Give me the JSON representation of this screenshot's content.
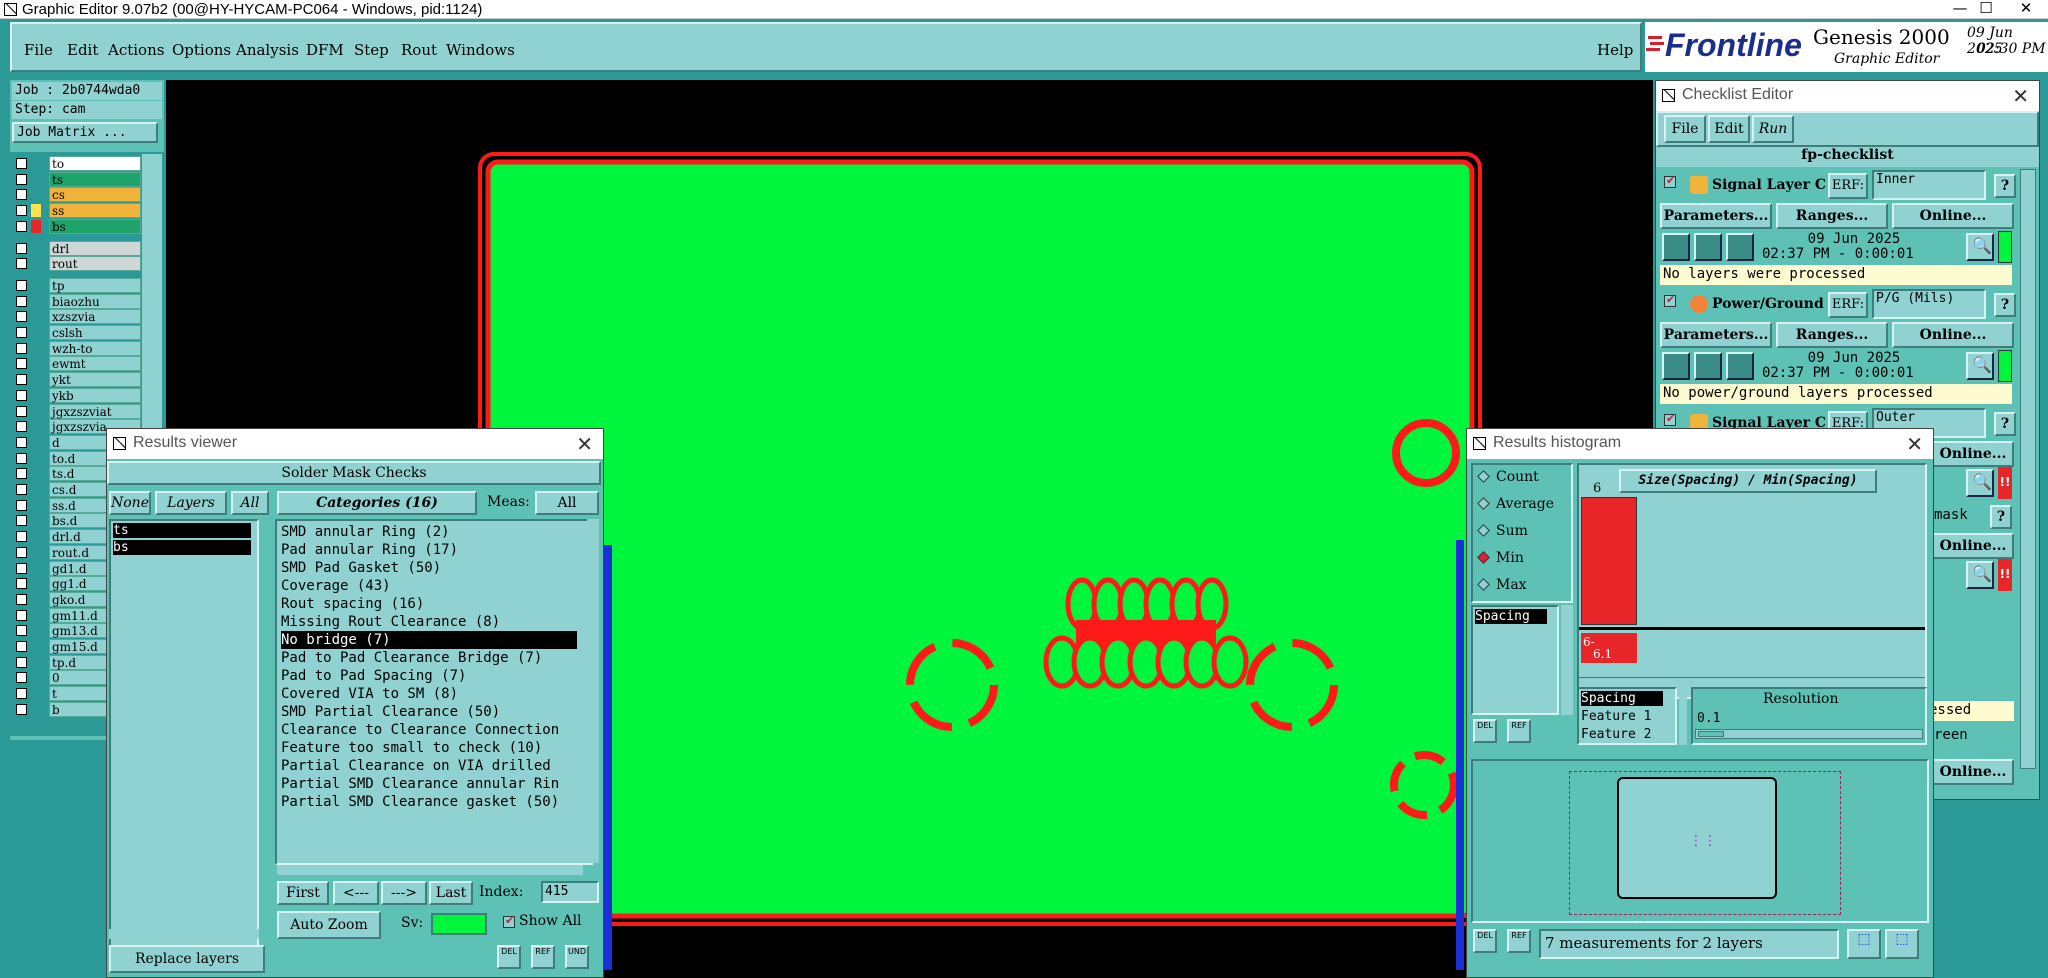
{
  "titlebar": {
    "title": "Graphic Editor 9.07b2 (00@HY-HYCAM-PC064 - Windows, pid:1124)",
    "min": "—",
    "max": "☐",
    "close": "✕"
  },
  "menubar": {
    "items": [
      "File",
      "Edit",
      "Actions",
      "Options",
      "Analysis",
      "DFM",
      "Step",
      "Rout",
      "Windows"
    ],
    "help": "Help"
  },
  "logo": {
    "brand": "Frontline",
    "product": "Genesis 2000",
    "sub": "Graphic Editor",
    "date": "09 Jun 2025",
    "time": "02:30 PM"
  },
  "left_panel": {
    "job": "Job : 2b0744wda0",
    "step": "Step: cam",
    "job_matrix": "Job Matrix ...",
    "layers": [
      {
        "name": "to",
        "color": "#ffffff",
        "swatch": ""
      },
      {
        "name": "ts",
        "color": "#1ea46a",
        "swatch": ""
      },
      {
        "name": "cs",
        "color": "#f1b43a",
        "swatch": ""
      },
      {
        "name": "ss",
        "color": "#f1b43a",
        "swatch": "#ffe14d"
      },
      {
        "name": "bs",
        "color": "#1ea46a",
        "swatch": "#e8262a"
      }
    ],
    "layers2": [
      "drl",
      "rout"
    ],
    "layers3": [
      "tp",
      "biaozhu",
      "xzszvia",
      "cslsh",
      "wzh-to",
      "ewmt",
      "ykt",
      "ykb",
      "jgxzszviat",
      "jgxzszvia",
      "d",
      "to.d",
      "ts.d",
      "cs.d",
      "ss.d",
      "bs.d",
      "drl.d",
      "rout.d",
      "gd1.d",
      "gg1.d",
      "gko.d",
      "gm11.d",
      "gm13.d",
      "gm15.d",
      "tp.d",
      "0",
      "t",
      "b"
    ]
  },
  "results_viewer": {
    "title": "Results viewer",
    "header": "Solder Mask Checks",
    "none_btn": "None",
    "layers_btn": "Layers",
    "all_btn": "All",
    "categories_btn": "Categories (16)",
    "meas_label": "Meas:",
    "meas_value": "All",
    "layer_list": [
      "ts",
      "bs"
    ],
    "categories": [
      "SMD annular Ring (2)",
      "Pad annular Ring (17)",
      "SMD Pad Gasket (50)",
      "Coverage (43)",
      "Rout spacing (16)",
      "Missing Rout Clearance (8)",
      "No bridge (7)",
      "Pad to Pad Clearance Bridge (7)",
      "Pad to Pad Spacing (7)",
      "Covered VIA to SM (8)",
      "SMD Partial Clearance (50)",
      "Clearance to Clearance Connection",
      "Feature too small to check (10)",
      "Partial Clearance on VIA drilled",
      "Partial SMD Clearance annular Rin",
      "Partial SMD Clearance gasket (50)"
    ],
    "selected_index": 6,
    "nav": {
      "first": "First",
      "prev": "<---",
      "next": "--->",
      "last": "Last",
      "index_label": "Index:",
      "index_value": "415"
    },
    "auto_zoom": "Auto Zoom",
    "sv_label": "Sv:",
    "show_all": "Show All",
    "replace_layers": "Replace layers",
    "del": "DEL",
    "ref": "REF",
    "und": "UND"
  },
  "histogram": {
    "title": "Results histogram",
    "modes": [
      "Count",
      "Average",
      "Sum",
      "Min",
      "Max"
    ],
    "selected_mode": "Min",
    "meas_list": [
      "Spacing"
    ],
    "chart_title": "Size(Spacing) / Min(Spacing)",
    "bar_label": "6",
    "bar_value": 6,
    "axis_label_top": "6-",
    "axis_label_bottom": "6.1",
    "options": [
      "Spacing",
      "Feature 1",
      "Feature 2"
    ],
    "resolution_label": "Resolution",
    "resolution_value": "0.1",
    "status": "7 measurements for 2 layers",
    "del": "DEL",
    "ref": "REF"
  },
  "checklist": {
    "title": "Checklist Editor",
    "menu": [
      "File",
      "Edit",
      "Run"
    ],
    "name": "fp-checklist",
    "erf": "ERF:",
    "items": [
      {
        "name": "Signal Layer Ch",
        "erf_value": "Inner",
        "date": "09 Jun 2025",
        "time": "02:37 PM - 0:00:01",
        "msg": "No layers were processed"
      },
      {
        "name": "Power/Ground C",
        "erf_value": "P/G (Mils)",
        "date": "09 Jun 2025",
        "time": "02:37 PM - 0:00:01",
        "msg": "No power/ground layers processed"
      },
      {
        "name": "Signal Layer Ch",
        "erf_value": "Outer"
      }
    ],
    "params_btn": "Parameters...",
    "ranges_btn": "Ranges...",
    "online_btn": "Online...",
    "help_btn": "?",
    "partial": [
      "Online...",
      "mask",
      "Online...",
      "essed",
      "reen",
      "Online..."
    ]
  },
  "colors": {
    "board": "#00f53d",
    "outline": "#ff1a1a",
    "panel": "#5dc2b5",
    "menubar": "#8fd2d1"
  }
}
